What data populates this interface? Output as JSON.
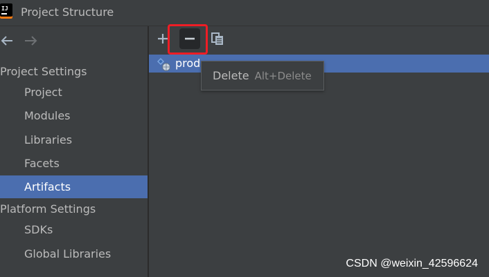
{
  "window": {
    "title": "Project Structure",
    "app_icon_text": "IJ"
  },
  "sidebar": {
    "project_settings_header": "Project Settings",
    "project_items": [
      {
        "label": "Project"
      },
      {
        "label": "Modules"
      },
      {
        "label": "Libraries"
      },
      {
        "label": "Facets"
      },
      {
        "label": "Artifacts",
        "selected": true
      }
    ],
    "platform_settings_header": "Platform Settings",
    "platform_items": [
      {
        "label": "SDKs"
      },
      {
        "label": "Global Libraries"
      }
    ]
  },
  "toolbar": {
    "add_icon": "plus-icon",
    "remove_icon": "minus-icon",
    "copy_icon": "copy-icon"
  },
  "artifacts": {
    "rows": [
      {
        "label": "prod  ...",
        "selected": true,
        "icon": "artifact-icon"
      }
    ]
  },
  "tooltip": {
    "action": "Delete",
    "shortcut": "Alt+Delete"
  },
  "watermark": "CSDN @weixin_42596624",
  "colors": {
    "background": "#3c3f41",
    "selection": "#4b6eaf",
    "highlight_border": "#ee1d25",
    "text": "#bbbbbb"
  }
}
